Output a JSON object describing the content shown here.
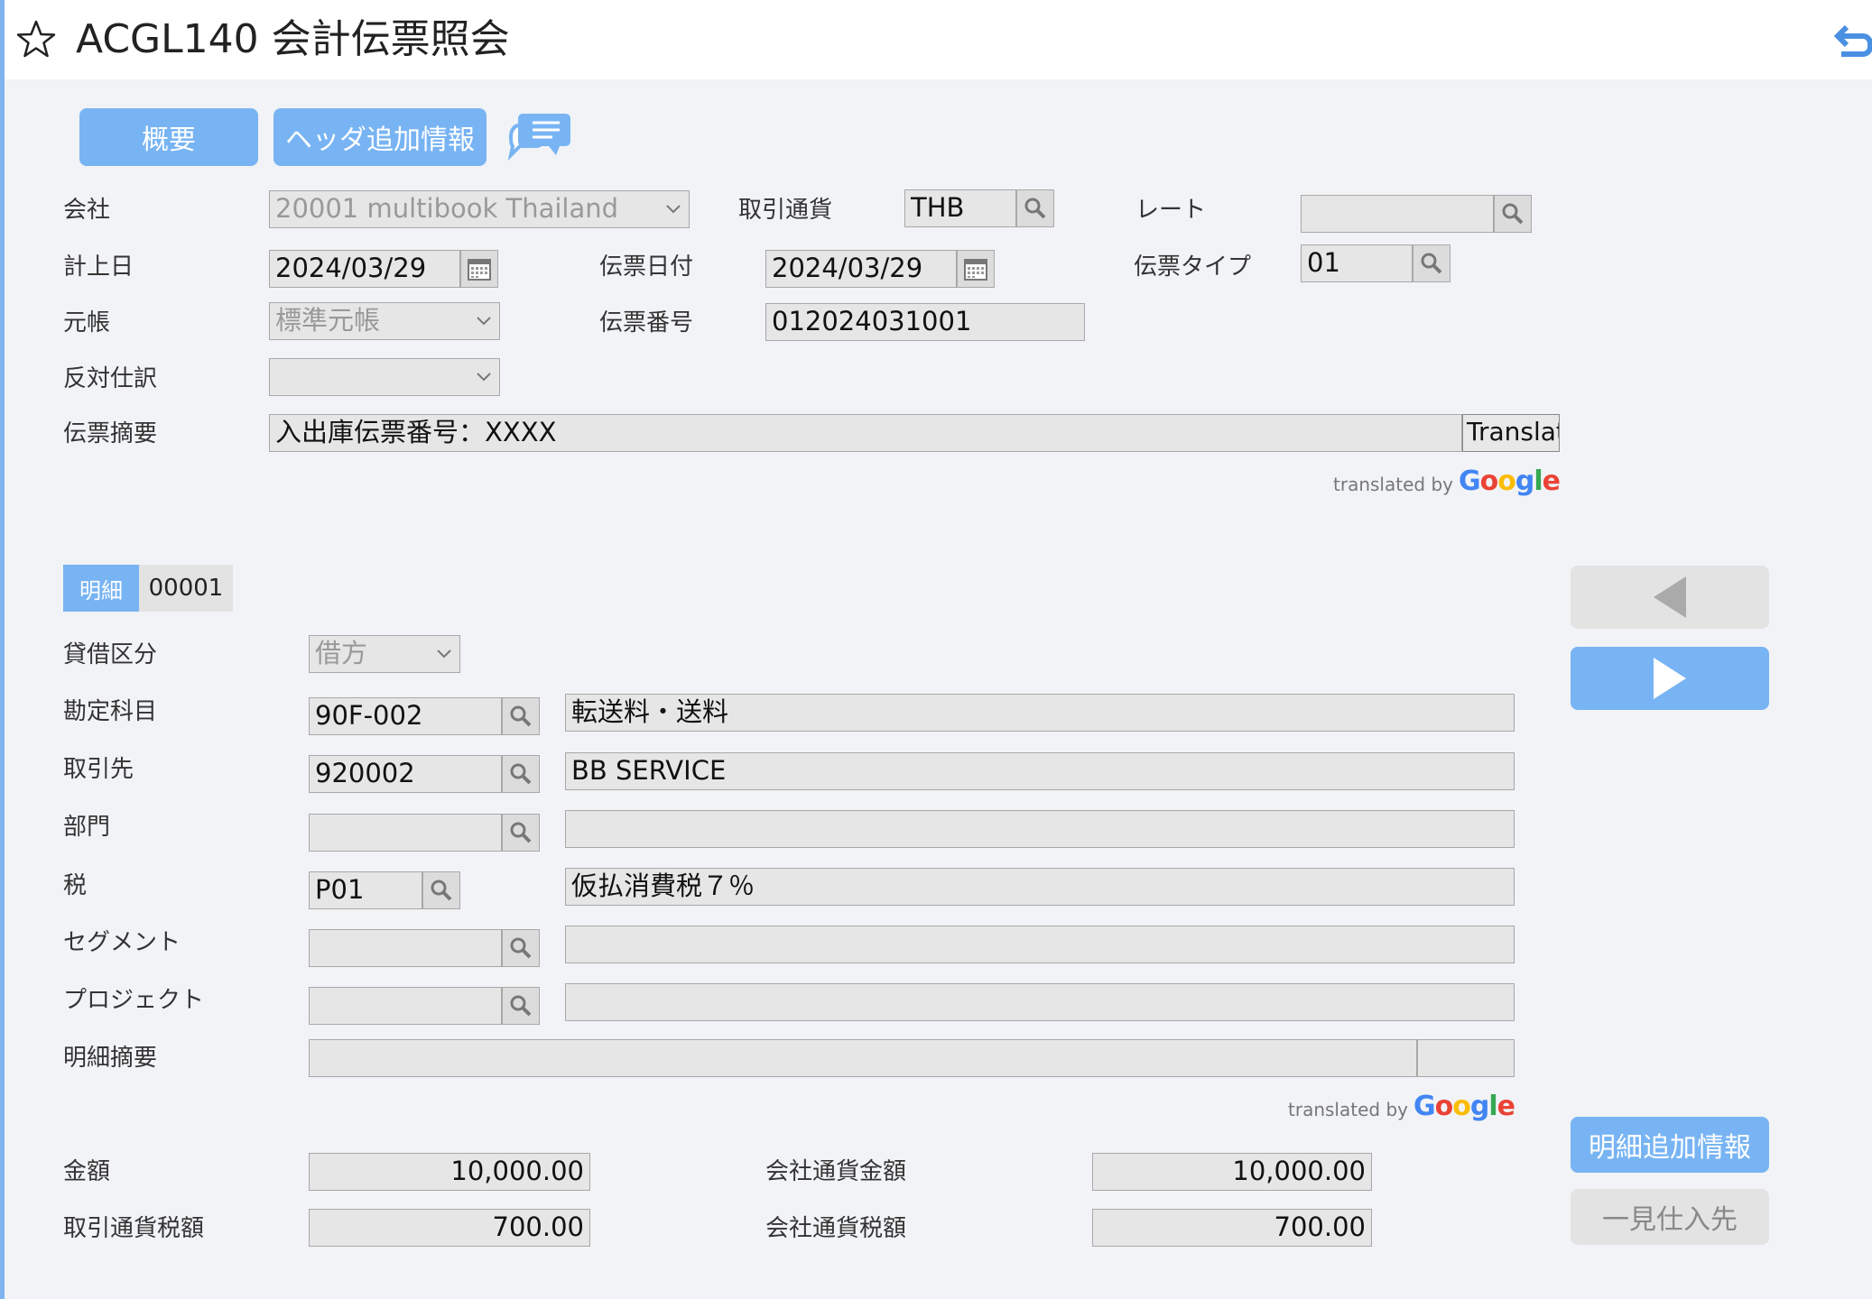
{
  "header": {
    "title": "ACGL140 会計伝票照会"
  },
  "tabs": {
    "overview": "概要",
    "header_extra": "ヘッダ追加情報"
  },
  "icons": {
    "favorite": "star-icon",
    "back": "return-arrow-icon",
    "comment": "chat-bubble-icon",
    "lookup": "magnifier-icon",
    "calendar": "calendar-icon"
  },
  "colors": {
    "accent": "#78b4f3",
    "field_bg": "#e6e6e6",
    "page_bg": "#f1f3f6"
  },
  "form": {
    "company": {
      "label": "会社",
      "value": "20001 multibook Thailand"
    },
    "currency": {
      "label": "取引通貨",
      "value": "THB"
    },
    "rate": {
      "label": "レート",
      "value": ""
    },
    "posting_date": {
      "label": "計上日",
      "value": "2024/03/29"
    },
    "voucher_date": {
      "label": "伝票日付",
      "value": "2024/03/29"
    },
    "voucher_type": {
      "label": "伝票タイプ",
      "value": "01"
    },
    "ledger": {
      "label": "元帳",
      "value": "標準元帳"
    },
    "voucher_no": {
      "label": "伝票番号",
      "value": "012024031001"
    },
    "reverse_entry": {
      "label": "反対仕訳",
      "value": ""
    },
    "summary": {
      "label": "伝票摘要",
      "value": "入出庫伝票番号：XXXX",
      "translate": "Translat"
    }
  },
  "google": {
    "translated_by": "translated by",
    "word": [
      "G",
      "o",
      "o",
      "g",
      "l",
      "e"
    ]
  },
  "detail": {
    "tab_label": "明細",
    "line_no": "00001",
    "debit_credit": {
      "label": "貸借区分",
      "value": "借方"
    },
    "account": {
      "label": "勘定科目",
      "code": "90F-002",
      "name": "転送料・送料"
    },
    "partner": {
      "label": "取引先",
      "code": "920002",
      "name": "BB SERVICE"
    },
    "department": {
      "label": "部門",
      "code": "",
      "name": ""
    },
    "tax": {
      "label": "税",
      "code": "P01",
      "name": "仮払消費税７％"
    },
    "segment": {
      "label": "セグメント",
      "code": "",
      "name": ""
    },
    "project": {
      "label": "プロジェクト",
      "code": "",
      "name": ""
    },
    "line_summary": {
      "label": "明細摘要",
      "value": "",
      "extra": ""
    },
    "amount": {
      "label": "金額",
      "value": "10,000.00"
    },
    "company_amount": {
      "label": "会社通貨金額",
      "value": "10,000.00"
    },
    "tax_amount": {
      "label": "取引通貨税額",
      "value": "700.00"
    },
    "company_tax": {
      "label": "会社通貨税額",
      "value": "700.00"
    }
  },
  "side_buttons": {
    "detail_extra": "明細追加情報",
    "one_time_vendor": "一見仕入先"
  }
}
